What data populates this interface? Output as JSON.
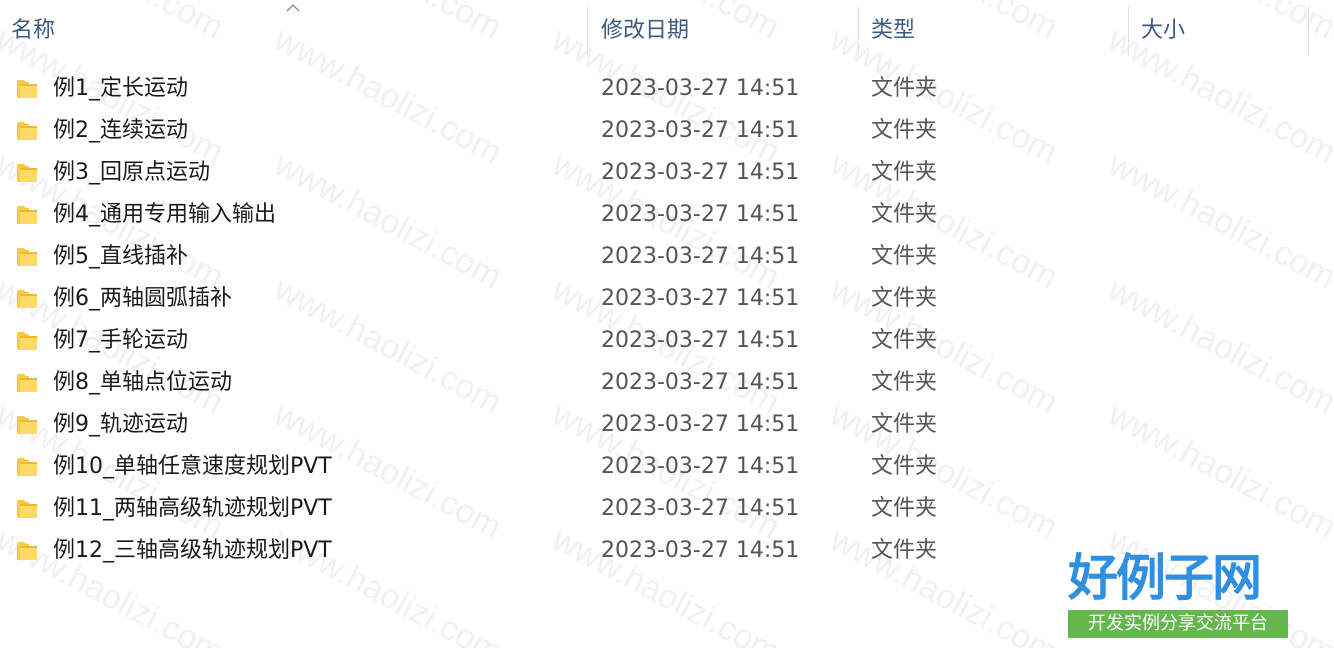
{
  "columns": {
    "name": "名称",
    "date": "修改日期",
    "type": "类型",
    "size": "大小"
  },
  "sort": {
    "column": "name",
    "direction": "ascending"
  },
  "folder_icon_color": "#f7c948",
  "files": [
    {
      "name": "例1_定长运动",
      "date": "2023-03-27 14:51",
      "type": "文件夹",
      "icon": "folder-icon"
    },
    {
      "name": "例2_连续运动",
      "date": "2023-03-27 14:51",
      "type": "文件夹",
      "icon": "folder-icon"
    },
    {
      "name": "例3_回原点运动",
      "date": "2023-03-27 14:51",
      "type": "文件夹",
      "icon": "folder-icon"
    },
    {
      "name": "例4_通用专用输入输出",
      "date": "2023-03-27 14:51",
      "type": "文件夹",
      "icon": "folder-icon"
    },
    {
      "name": "例5_直线插补",
      "date": "2023-03-27 14:51",
      "type": "文件夹",
      "icon": "folder-icon"
    },
    {
      "name": "例6_两轴圆弧插补",
      "date": "2023-03-27 14:51",
      "type": "文件夹",
      "icon": "folder-icon"
    },
    {
      "name": "例7_手轮运动",
      "date": "2023-03-27 14:51",
      "type": "文件夹",
      "icon": "folder-icon"
    },
    {
      "name": "例8_单轴点位运动",
      "date": "2023-03-27 14:51",
      "type": "文件夹",
      "icon": "folder-icon"
    },
    {
      "name": "例9_轨迹运动",
      "date": "2023-03-27 14:51",
      "type": "文件夹",
      "icon": "folder-icon"
    },
    {
      "name": "例10_单轴任意速度规划PVT",
      "date": "2023-03-27 14:51",
      "type": "文件夹",
      "icon": "folder-icon"
    },
    {
      "name": "例11_两轴高级轨迹规划PVT",
      "date": "2023-03-27 14:51",
      "type": "文件夹",
      "icon": "folder-icon"
    },
    {
      "name": "例12_三轴高级轨迹规划PVT",
      "date": "2023-03-27 14:51",
      "type": "文件夹",
      "icon": "folder-icon"
    }
  ],
  "watermark": {
    "text": "www.haolizi.com"
  },
  "logo": {
    "main": "好例子网",
    "sub": "开发实例分享交流平台",
    "main_color": "#2f8fe0",
    "sub_bg": "#64b74c"
  }
}
